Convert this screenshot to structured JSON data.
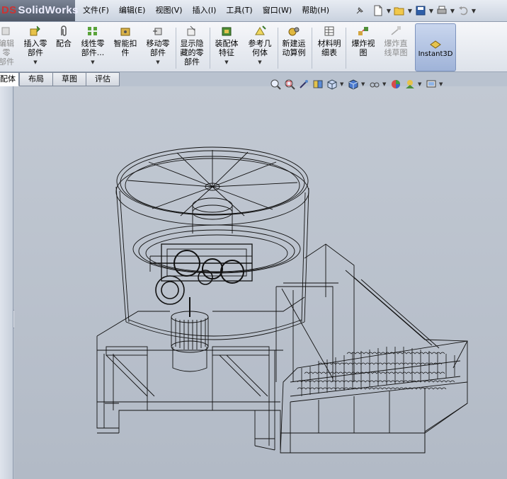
{
  "app": {
    "logo_text": "SolidWorks",
    "logo_mark": "DS"
  },
  "menu": {
    "items": [
      {
        "id": "file",
        "label": "文件(F)"
      },
      {
        "id": "edit",
        "label": "编辑(E)"
      },
      {
        "id": "view",
        "label": "视图(V)"
      },
      {
        "id": "insert",
        "label": "插入(I)"
      },
      {
        "id": "tools",
        "label": "工具(T)"
      },
      {
        "id": "window",
        "label": "窗口(W)"
      },
      {
        "id": "help",
        "label": "帮助(H)"
      }
    ]
  },
  "quick_toolbar": {
    "icons": [
      "pin-icon",
      "new-icon",
      "open-icon",
      "save-icon",
      "print-icon",
      "undo-icon"
    ]
  },
  "ribbon": {
    "buttons": [
      {
        "id": "edit-component",
        "label": "编辑零\n部件",
        "disabled": true
      },
      {
        "id": "insert-component",
        "label": "插入零\n部件",
        "dropdown": true
      },
      {
        "id": "mate",
        "label": "配合"
      },
      {
        "id": "linear-pattern",
        "label": "线性零\n部件...",
        "dropdown": true
      },
      {
        "id": "smart-fastener",
        "label": "智能扣\n件"
      },
      {
        "id": "move-component",
        "label": "移动零\n部件",
        "dropdown": true
      },
      {
        "id": "show-hidden",
        "label": "显示隐\n藏的零\n部件"
      },
      {
        "id": "assembly-feature",
        "label": "装配体\n特征",
        "dropdown": true
      },
      {
        "id": "reference-geometry",
        "label": "参考几\n何体",
        "dropdown": true
      },
      {
        "id": "new-motion-study",
        "label": "新建运\n动算例"
      },
      {
        "id": "bom",
        "label": "材料明\n细表"
      },
      {
        "id": "exploded-view",
        "label": "爆炸视\n图"
      },
      {
        "id": "explode-line-sketch",
        "label": "爆炸直\n线草图",
        "disabled": true
      },
      {
        "id": "instant3d",
        "label": "Instant3D",
        "active": true
      }
    ]
  },
  "tabs": [
    {
      "id": "assembly",
      "label": "配体",
      "active": true
    },
    {
      "id": "layout",
      "label": "布局"
    },
    {
      "id": "sketch",
      "label": "草图"
    },
    {
      "id": "evaluate",
      "label": "评估"
    }
  ],
  "view_toolbar": {
    "icons": [
      "zoom-to-fit-icon",
      "zoom-area-icon",
      "previous-view-icon",
      "section-view-icon",
      "view-orientation-icon",
      "display-style-icon",
      "hide-show-icon",
      "appearance-icon",
      "scene-icon",
      "view-settings-icon"
    ]
  },
  "colors": {
    "viewport_top": "#c2c9d3",
    "viewport_bottom": "#b2bac6",
    "wireframe": "#111111",
    "instant3d_bg": "#a8bbe0"
  }
}
